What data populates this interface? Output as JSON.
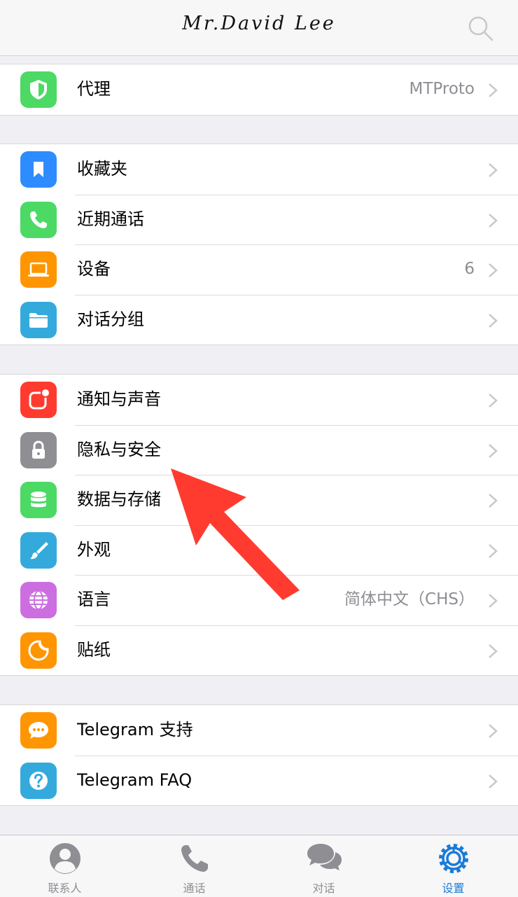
{
  "header": {
    "title": "Mr.David Lee",
    "search_icon": "search-icon"
  },
  "groups": [
    {
      "items": [
        {
          "label": "代理",
          "value": "MTProto",
          "icon": "shield-icon",
          "color": "#4cd964"
        }
      ]
    },
    {
      "items": [
        {
          "label": "收藏夹",
          "value": "",
          "icon": "bookmark-icon",
          "color": "#2d8cff"
        },
        {
          "label": "近期通话",
          "value": "",
          "icon": "phone-icon",
          "color": "#4cd964"
        },
        {
          "label": "设备",
          "value": "6",
          "icon": "laptop-icon",
          "color": "#ff9500"
        },
        {
          "label": "对话分组",
          "value": "",
          "icon": "folder-icon",
          "color": "#34aadc"
        }
      ]
    },
    {
      "items": [
        {
          "label": "通知与声音",
          "value": "",
          "icon": "notification-icon",
          "color": "#ff3b30"
        },
        {
          "label": "隐私与安全",
          "value": "",
          "icon": "lock-icon",
          "color": "#8e8e93"
        },
        {
          "label": "数据与存储",
          "value": "",
          "icon": "database-icon",
          "color": "#4cd964"
        },
        {
          "label": "外观",
          "value": "",
          "icon": "brush-icon",
          "color": "#34aadc"
        },
        {
          "label": "语言",
          "value": "简体中文（CHS）",
          "icon": "globe-icon",
          "color": "#cc6ee0"
        },
        {
          "label": "贴纸",
          "value": "",
          "icon": "sticker-icon",
          "color": "#ff9500"
        }
      ]
    },
    {
      "items": [
        {
          "label": "Telegram 支持",
          "value": "",
          "icon": "chat-bubble-icon",
          "color": "#ff9500"
        },
        {
          "label": "Telegram FAQ",
          "value": "",
          "icon": "question-icon",
          "color": "#34aadc"
        }
      ]
    }
  ],
  "tabs": [
    {
      "label": "联系人",
      "icon": "contacts-icon",
      "active": false
    },
    {
      "label": "通话",
      "icon": "phone-icon",
      "active": false
    },
    {
      "label": "对话",
      "icon": "chats-icon",
      "active": false
    },
    {
      "label": "设置",
      "icon": "settings-gear-icon",
      "active": true
    }
  ],
  "annotation": {
    "icon": "red-arrow-icon",
    "color": "#ff3b30"
  }
}
